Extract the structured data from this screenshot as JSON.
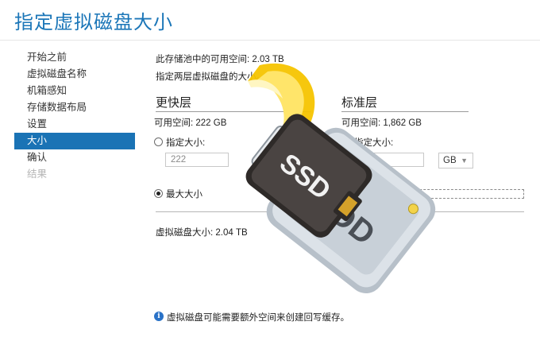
{
  "window": {
    "title": "指定虚拟磁盘大小"
  },
  "nav": {
    "items": [
      {
        "label": "开始之前",
        "state": "normal"
      },
      {
        "label": "虚拟磁盘名称",
        "state": "normal"
      },
      {
        "label": "机箱感知",
        "state": "normal"
      },
      {
        "label": "存储数据布局",
        "state": "normal"
      },
      {
        "label": "设置",
        "state": "normal"
      },
      {
        "label": "大小",
        "state": "active"
      },
      {
        "label": "确认",
        "state": "normal"
      },
      {
        "label": "结果",
        "state": "disabled"
      }
    ]
  },
  "main": {
    "pool_free_space": "此存储池中的可用空间: 2.03 TB",
    "instruction": "指定两层虚拟磁盘的大小。",
    "faster_tier": {
      "heading": "更快层",
      "free_space": "可用空间: 222 GB",
      "specify_label": "指定大小:",
      "value": "222"
    },
    "standard_tier": {
      "heading": "标准层",
      "free_space": "可用空间: 1,862 GB",
      "specify_label": "指定大小:",
      "unit": "GB"
    },
    "max_size_label": "最大大小",
    "disk_size": "虚拟磁盘大小: 2.04 TB",
    "note": "虚拟磁盘可能需要额外空间来创建回写缓存。"
  },
  "illustration": {
    "ssd_label": "SSD",
    "hdd_label": "HDD",
    "icons": [
      "ssd-drive-icon",
      "hdd-drive-icon",
      "speed-swoosh-icon"
    ],
    "colors": {
      "accent": "#1a73b5",
      "swoosh": "#f5c400",
      "ssd_body": "#3c3734",
      "hdd_body": "#c4ccd4"
    }
  }
}
